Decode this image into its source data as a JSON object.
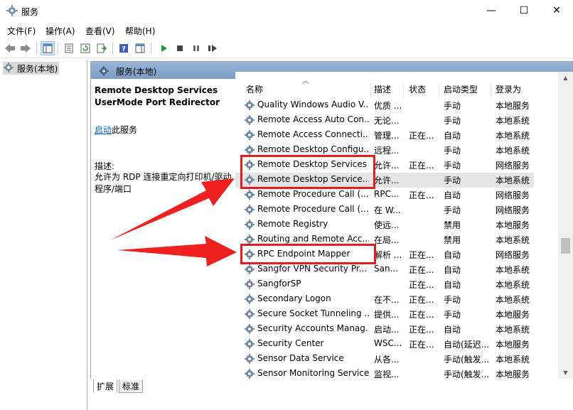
{
  "window": {
    "title": "服务",
    "minimize": "—",
    "maximize": "☐",
    "close": "✕"
  },
  "menu": [
    "文件(F)",
    "操作(A)",
    "查看(V)",
    "帮助(H)"
  ],
  "tree": {
    "item": "服务(本地)"
  },
  "panel": {
    "header": "服务(本地)",
    "service_title": "Remote Desktop Services UserMode Port Redirector",
    "start_link": "启动",
    "start_suffix": "此服务",
    "desc_label": "描述:",
    "desc_text": "允许为 RDP 连接重定向打印机/驱动程序/端口"
  },
  "columns": {
    "name": "名称",
    "desc": "描述",
    "status": "状态",
    "startup": "启动类型",
    "logon": "登录为"
  },
  "rows": [
    {
      "name": "Quality Windows Audio V...",
      "desc": "优质 ...",
      "status": "",
      "startup": "手动",
      "logon": "本地服务"
    },
    {
      "name": "Remote Access Auto Con...",
      "desc": "无论...",
      "status": "",
      "startup": "手动",
      "logon": "本地系统"
    },
    {
      "name": "Remote Access Connecti...",
      "desc": "管理...",
      "status": "正在...",
      "startup": "自动",
      "logon": "本地系统"
    },
    {
      "name": "Remote Desktop Configu...",
      "desc": "远程...",
      "status": "",
      "startup": "手动",
      "logon": "本地系统"
    },
    {
      "name": "Remote Desktop Services",
      "desc": "允许...",
      "status": "正在...",
      "startup": "手动",
      "logon": "网络服务"
    },
    {
      "name": "Remote Desktop Service...",
      "desc": "允许...",
      "status": "",
      "startup": "手动",
      "logon": "本地系统"
    },
    {
      "name": "Remote Procedure Call (...",
      "desc": "RPC...",
      "status": "正在...",
      "startup": "自动",
      "logon": "网络服务"
    },
    {
      "name": "Remote Procedure Call (...",
      "desc": "在 W...",
      "status": "",
      "startup": "手动",
      "logon": "网络服务"
    },
    {
      "name": "Remote Registry",
      "desc": "使远...",
      "status": "",
      "startup": "禁用",
      "logon": "本地服务"
    },
    {
      "name": "Routing and Remote Acc...",
      "desc": "在局...",
      "status": "",
      "startup": "禁用",
      "logon": "本地系统"
    },
    {
      "name": "RPC Endpoint Mapper",
      "desc": "解析 ...",
      "status": "正在...",
      "startup": "自动",
      "logon": "网络服务"
    },
    {
      "name": "Sangfor VPN Security Pr...",
      "desc": "San...",
      "status": "正在...",
      "startup": "自动",
      "logon": "本地系统"
    },
    {
      "name": "SangforSP",
      "desc": "",
      "status": "正在...",
      "startup": "自动",
      "logon": "本地系统"
    },
    {
      "name": "Secondary Logon",
      "desc": "在不...",
      "status": "正在...",
      "startup": "手动",
      "logon": "本地系统"
    },
    {
      "name": "Secure Socket Tunneling ...",
      "desc": "提供...",
      "status": "正在...",
      "startup": "手动",
      "logon": "本地服务"
    },
    {
      "name": "Security Accounts Manag...",
      "desc": "启动...",
      "status": "正在...",
      "startup": "自动",
      "logon": "本地系统"
    },
    {
      "name": "Security Center",
      "desc": "WSC...",
      "status": "正在...",
      "startup": "自动(延迟...",
      "logon": "本地服务"
    },
    {
      "name": "Sensor Data Service",
      "desc": "从各...",
      "status": "",
      "startup": "手动(触发...",
      "logon": "本地系统"
    },
    {
      "name": "Sensor Monitoring Service",
      "desc": "监视...",
      "status": "",
      "startup": "手动(触发...",
      "logon": "本地服务"
    }
  ],
  "tabs": [
    "扩展",
    "标准"
  ],
  "colors": {
    "annotation_red": "#e02020",
    "header_blue": "#8aaad0"
  }
}
